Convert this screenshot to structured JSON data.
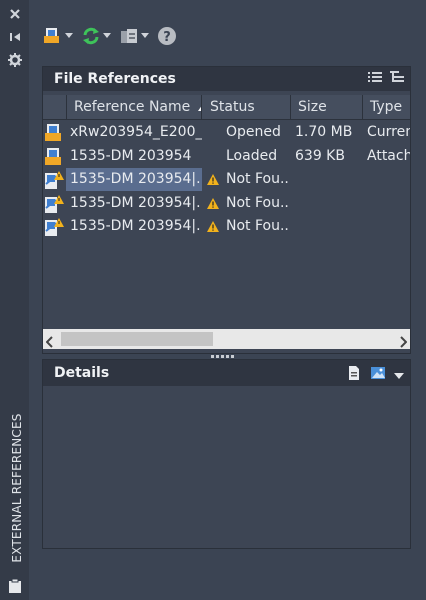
{
  "strip": {
    "title": "EXTERNAL REFERENCES"
  },
  "file_refs": {
    "title": "File References",
    "columns": [
      "Reference Name",
      "Status",
      "Size",
      "Type"
    ],
    "rows": [
      {
        "name": "xRw203954_E200_...",
        "status": "Opened",
        "size": "1.70 MB",
        "type": "Curren"
      },
      {
        "name": "1535-DM 203954",
        "status": "Loaded",
        "size": "639 KB",
        "type": "Attach"
      },
      {
        "name": "1535-DM 203954|...",
        "status": "Not Fou...",
        "size": "",
        "type": ""
      },
      {
        "name": "1535-DM 203954|...",
        "status": "Not Fou...",
        "size": "",
        "type": ""
      },
      {
        "name": "1535-DM 203954|...",
        "status": "Not Fou...",
        "size": "",
        "type": ""
      }
    ]
  },
  "details": {
    "title": "Details"
  },
  "colors": {
    "warning": "#f2b21c",
    "selection": "#5a6d8f",
    "refresh": "#3ec35a",
    "help_bg": "#b8bcc2"
  }
}
